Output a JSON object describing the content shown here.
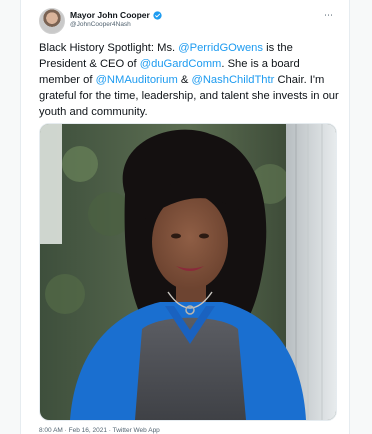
{
  "tweet": {
    "author_name": "Mayor John Cooper",
    "author_handle": "@JohnCooper4Nash",
    "more_glyph": "⋯",
    "text_segments": [
      {
        "text": "Black History Spotlight: Ms. ",
        "type": "text"
      },
      {
        "text": "@PerridGOwens",
        "type": "mention"
      },
      {
        "text": " is the President & CEO of ",
        "type": "text"
      },
      {
        "text": "@duGardComm",
        "type": "mention"
      },
      {
        "text": ". She is a board member of ",
        "type": "text"
      },
      {
        "text": "@NMAuditorium",
        "type": "mention"
      },
      {
        "text": " & ",
        "type": "text"
      },
      {
        "text": "@NashChildThtr",
        "type": "mention"
      },
      {
        "text": " Chair. I'm grateful for the time, leadership, and talent she invests in our youth and community.",
        "type": "text"
      }
    ],
    "footer": "8:00 AM · Feb 16, 2021 · Twitter Web App"
  },
  "icons": {
    "verified": "verified-badge-icon",
    "more": "more-options-icon",
    "avatar": "author-avatar"
  },
  "colors": {
    "mention": "#1d9bf0",
    "text": "#0f1419",
    "muted": "#536471",
    "verified": "#1d9bf0"
  }
}
